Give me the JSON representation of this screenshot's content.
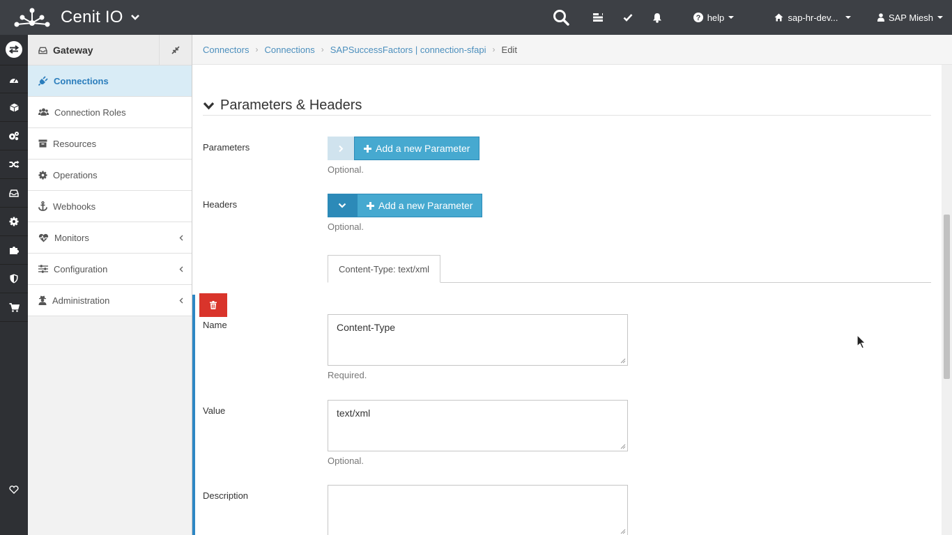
{
  "topbar": {
    "brand": "Cenit IO",
    "help_label": "help",
    "tenant_label": "sap-hr-dev...",
    "user_label": "SAP Miesh",
    "icons": [
      "logo-icon",
      "chevron-down-icon",
      "search-icon",
      "tasks-icon",
      "check-icon",
      "bell-icon",
      "question-icon",
      "home-icon",
      "user-icon"
    ]
  },
  "iconbar": {
    "items": [
      "exchange-icon",
      "dashboard-icon",
      "cube-icon",
      "cogs-icon",
      "random-icon",
      "inbox-icon",
      "gear-icon",
      "puzzle-icon",
      "shield-icon",
      "cart-icon",
      "heart-icon"
    ]
  },
  "sidebar": {
    "title": "Gateway",
    "items": [
      {
        "label": "Connections",
        "icon": "plug-icon",
        "active": true
      },
      {
        "label": "Connection Roles",
        "icon": "users-icon"
      },
      {
        "label": "Resources",
        "icon": "archive-icon"
      },
      {
        "label": "Operations",
        "icon": "gear-icon"
      },
      {
        "label": "Webhooks",
        "icon": "anchor-icon"
      },
      {
        "label": "Monitors",
        "icon": "heartbeat-icon",
        "has_children": true
      },
      {
        "label": "Configuration",
        "icon": "sliders-icon",
        "has_children": true
      },
      {
        "label": "Administration",
        "icon": "user-secret-icon",
        "has_children": true
      }
    ]
  },
  "breadcrumb": {
    "items": [
      "Connectors",
      "Connections",
      "SAPSuccessFactors | connection-sfapi"
    ],
    "current": "Edit"
  },
  "form": {
    "section_title": "Parameters & Headers",
    "parameters": {
      "label": "Parameters",
      "button": "Add a new Parameter",
      "help": "Optional."
    },
    "headers": {
      "label": "Headers",
      "button": "Add a new Parameter",
      "help": "Optional."
    },
    "header_tab": "Content-Type: text/xml",
    "name": {
      "label": "Name",
      "value": "Content-Type",
      "help": "Required."
    },
    "value": {
      "label": "Value",
      "value": "text/xml",
      "help": "Optional."
    },
    "description": {
      "label": "Description",
      "value": ""
    }
  },
  "colors": {
    "topbar": "#3d4045",
    "iconbar": "#2e3034",
    "accent": "#2e87c4",
    "button": "#46a9d0",
    "danger": "#d9342b",
    "link": "#4c8fbd"
  }
}
